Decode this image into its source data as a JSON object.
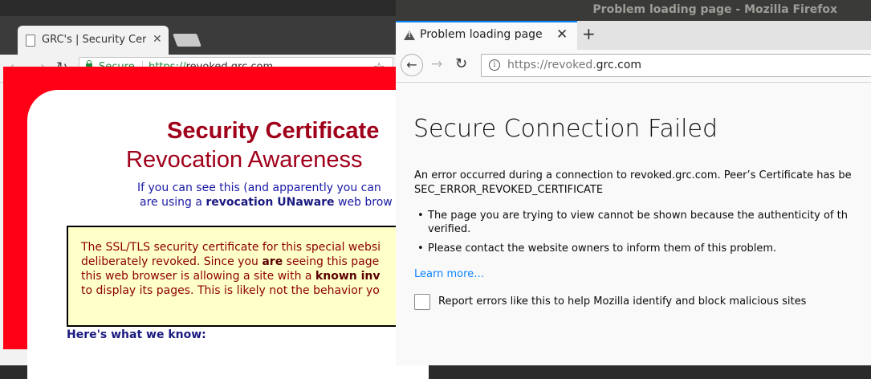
{
  "chrome": {
    "tab_title": "GRC's | Security Certificate",
    "tab_close": "✕",
    "secure_label": "Secure",
    "url_scheme": "https://",
    "url_rest": "revoked.grc.com",
    "star": "☆",
    "back": "←",
    "forward": "→",
    "reload": "↻"
  },
  "grc": {
    "heading1": "Security Certificate",
    "heading2": "Revocation Awareness",
    "intro1": "If you can see this (and apparently you can",
    "intro2_a": "are using a ",
    "intro2_b": "revocation UNaware",
    "intro2_c": " web brow",
    "box_lines": [
      "The SSL/TLS security certificate for this special websi",
      "deliberately revoked.  Since you are seeing this page",
      "this web browser is allowing a site with a known inv",
      "to display its pages. This is likely not the behavior yo"
    ],
    "box_line2_a": "deliberately revoked.  Since you ",
    "box_line2_b": "are",
    "box_line2_c": " seeing this page",
    "box_line3_a": "this web browser is allowing a site with a ",
    "box_line3_b": "known inv",
    "know_heading": "Here's what we know:"
  },
  "firefox": {
    "window_title": "Problem loading page - Mozilla Firefox",
    "tab_title": "Problem loading page",
    "tab_close": "✕",
    "new_tab": "+",
    "back": "←",
    "forward": "→",
    "reload": "↻",
    "info": "i",
    "url_prefix": "https://revoked.",
    "url_domain": "grc.com",
    "error_title": "Secure Connection Failed",
    "error_desc": "An error occurred during a connection to revoked.grc.com. Peer’s Certificate has be",
    "error_code": "SEC_ERROR_REVOKED_CERTIFICATE",
    "bullets": [
      "The page you are trying to view cannot be shown because the authenticity of th",
      "verified.",
      "Please contact the website owners to inform them of this problem."
    ],
    "learn_more": "Learn more…",
    "report_label": "Report errors like this to help Mozilla identify and block malicious sites"
  }
}
